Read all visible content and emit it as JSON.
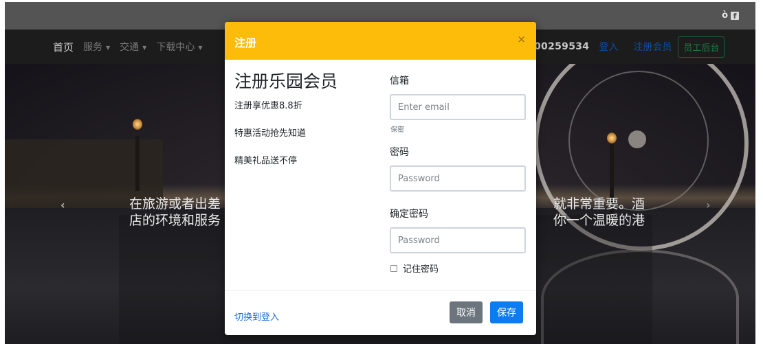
{
  "topbar": {
    "social_weibo": "ò",
    "social_facebook": "f"
  },
  "navbar": {
    "items": [
      {
        "label": "首页"
      },
      {
        "label": "服务"
      },
      {
        "label": "交通"
      },
      {
        "label": "下载中心"
      }
    ],
    "caret": "▼",
    "phone": "00259534",
    "login": "登入",
    "register": "注册会员",
    "staff": "员工后台"
  },
  "hero": {
    "prev_arrow": "‹",
    "next_arrow": "›",
    "caption_line1_left": "在旅游或者出差",
    "caption_line1_right": "就非常重要。酒",
    "caption_line2_left": "店的环境和服务",
    "caption_line2_right": "你一个温暖的港"
  },
  "modal": {
    "title": "注册",
    "close": "×",
    "heading": "注册乐园会员",
    "perks": [
      "注册享优惠8.8折",
      "特惠活动抢先知道",
      "精美礼品送不停"
    ],
    "email_label": "信箱",
    "email_placeholder": "Enter email",
    "email_help": "保密",
    "password_label": "密码",
    "password_placeholder": "Password",
    "confirm_label": "确定密码",
    "confirm_placeholder": "Password",
    "remember_label": "记住密码",
    "switch_link": "切换到登入",
    "cancel": "取消",
    "save": "保存"
  },
  "colors": {
    "modal_header": "#fdbc09",
    "primary": "#0d7cf2",
    "secondary": "#6c757d"
  }
}
